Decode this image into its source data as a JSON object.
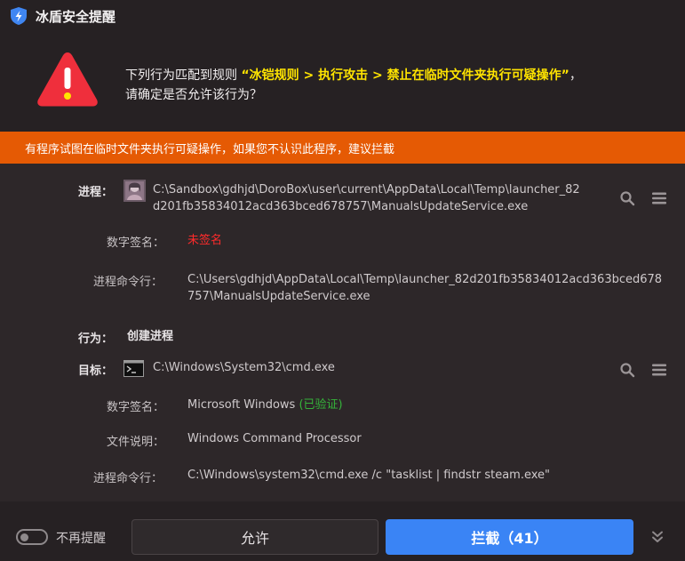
{
  "window": {
    "title": "冰盾安全提醒"
  },
  "header": {
    "line1_prefix": "下列行为匹配到规则 ",
    "rule": "“冰铠规则 > 执行攻击 > 禁止在临时文件夹执行可疑操作”",
    "line1_suffix": "，",
    "line2": "请确定是否允许该行为？"
  },
  "banner": {
    "text": "有程序试图在临时文件夹执行可疑操作，如果您不认识此程序，建议拦截"
  },
  "process": {
    "label": "进程：",
    "path_line1": "C:\\Sandbox\\gdhjd\\DoroBox\\user\\current\\AppData\\Local\\Temp\\launcher_82",
    "path_line2": "d201fb35834012acd363bced678757\\ManualsUpdateService.exe",
    "sig_label": "数字签名：",
    "sig_value": "未签名",
    "cmd_label": "进程命令行：",
    "cmd_line1": "C:\\Users\\gdhjd\\AppData\\Local\\Temp\\launcher_82d201fb35834012acd363bced678",
    "cmd_line2": "757\\ManualsUpdateService.exe"
  },
  "action": {
    "label": "行为：",
    "value": "创建进程"
  },
  "target": {
    "label": "目标：",
    "path": "C:\\Windows\\System32\\cmd.exe",
    "sig_label": "数字签名：",
    "sig_value": "Microsoft Windows",
    "sig_status": "(已验证)",
    "desc_label": "文件说明：",
    "desc_value": "Windows Command Processor",
    "cmd_label": "进程命令行：",
    "cmd_value": "C:\\Windows\\system32\\cmd.exe /c \"tasklist | findstr steam.exe\""
  },
  "footer": {
    "toggle_label": "不再提醒",
    "allow_label": "允许",
    "block_label": "拦截（41）"
  },
  "colors": {
    "accent": "#3a84f5",
    "banner": "#e55a04",
    "rule_highlight": "#ffe400",
    "unsigned": "#ff2b2b",
    "verified": "#35b33a"
  },
  "icons": {
    "logo": "shield-lightning-icon",
    "warning": "warning-triangle-icon",
    "search": "search-icon",
    "menu": "menu-icon",
    "collapse": "double-chevron-down-icon",
    "process": "app-thumbnail-icon",
    "target": "console-icon"
  }
}
